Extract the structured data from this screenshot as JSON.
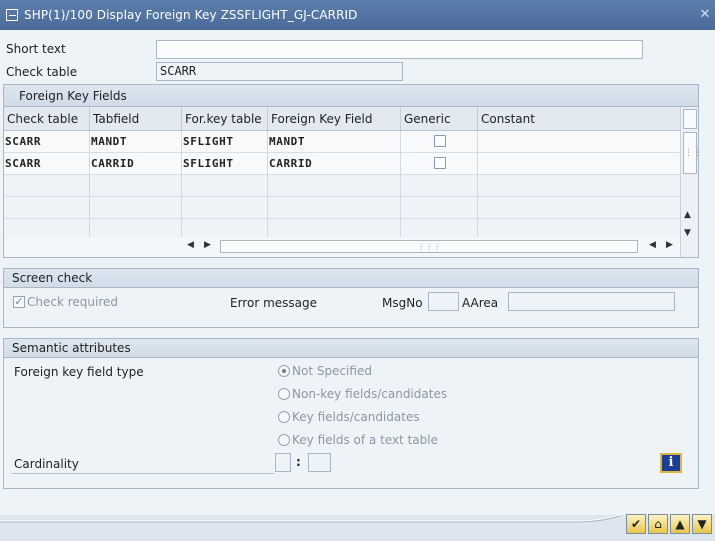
{
  "window": {
    "title": "SHP(1)/100 Display Foreign Key ZSSFLIGHT_GJ-CARRID",
    "close_icon": "close-icon"
  },
  "header": {
    "short_text_label": "Short text",
    "short_text_value": "",
    "check_table_label": "Check table",
    "check_table_value": "SCARR"
  },
  "fk_table": {
    "title": "Foreign Key Fields",
    "columns": [
      "Check table",
      "Tabfield",
      "For.key table",
      "Foreign Key Field",
      "Generic",
      "Constant"
    ],
    "rows": [
      {
        "check_table": "SCARR",
        "tabfield": "MANDT",
        "fk_table": "SFLIGHT",
        "fk_field": "MANDT",
        "generic": false,
        "constant": ""
      },
      {
        "check_table": "SCARR",
        "tabfield": "CARRID",
        "fk_table": "SFLIGHT",
        "fk_field": "CARRID",
        "generic": false,
        "constant": ""
      }
    ]
  },
  "screen_check": {
    "title": "Screen check",
    "check_required_label": "Check required",
    "check_required": true,
    "error_message_label": "Error message",
    "msgno_label": "MsgNo",
    "msgno_value": "",
    "aarea_label": "AArea",
    "aarea_value": ""
  },
  "semantic": {
    "title": "Semantic attributes",
    "fk_field_type_label": "Foreign key field type",
    "options": [
      {
        "label": "Not Specified",
        "selected": true
      },
      {
        "label": "Non-key fields/candidates",
        "selected": false
      },
      {
        "label": "Key fields/candidates",
        "selected": false
      },
      {
        "label": "Key fields of a text table",
        "selected": false
      }
    ],
    "cardinality_label": "Cardinality",
    "cardinality_left": "",
    "cardinality_sep": ":",
    "cardinality_right": "",
    "info_glyph": "i"
  },
  "footer": {
    "buttons": [
      "check-icon",
      "hierarchy-icon",
      "up-arrow-icon",
      "down-arrow-icon"
    ]
  }
}
